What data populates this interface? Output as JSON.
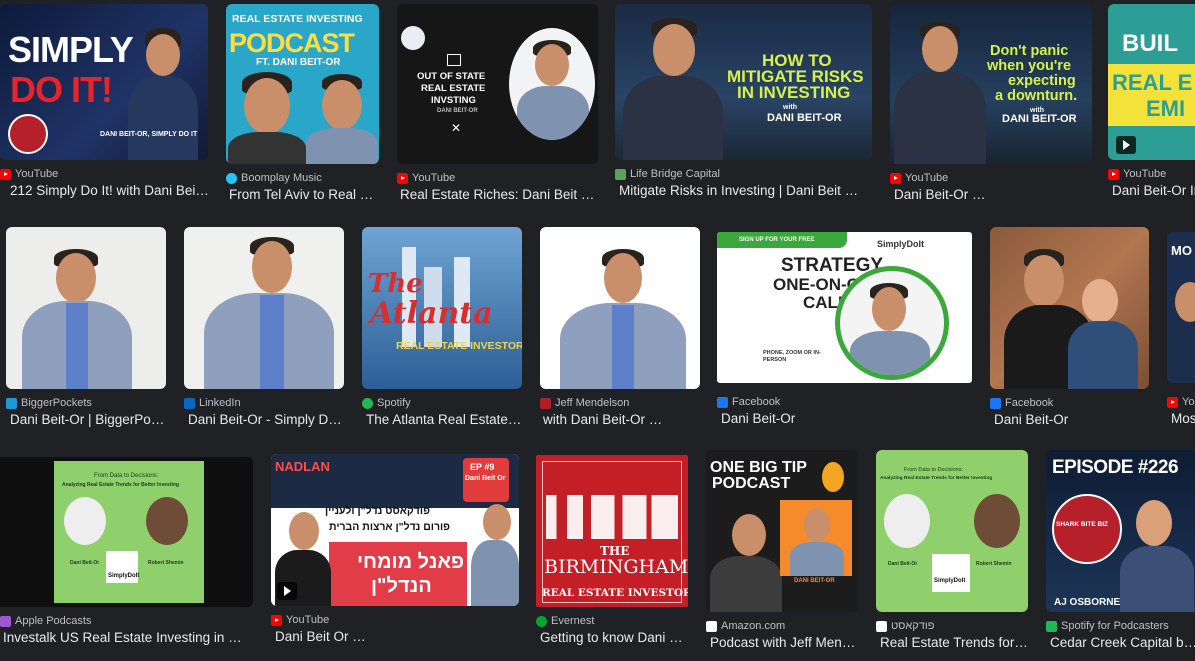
{
  "results": [
    {
      "source": "YouTube",
      "title": "212 Simply Do It! with Dani Bei…",
      "overlay": [
        "SIMPLY",
        "DO IT!",
        "DANI BEIT-OR, SIMPLY DO IT",
        "SHARK BITE BIZ"
      ]
    },
    {
      "source": "Boomplay Music",
      "title": "From Tel Aviv to Real …",
      "overlay": [
        "REAL ESTATE INVESTING",
        "PODCAST",
        "FT. DANI BEIT-OR"
      ]
    },
    {
      "source": "YouTube",
      "title": "Real Estate Riches: Dani Beit …",
      "overlay": [
        "OUT OF STATE",
        "REAL ESTATE",
        "INVSTING",
        "DANI BEIT-OR"
      ]
    },
    {
      "source": "Life Bridge Capital",
      "title": "Mitigate Risks in Investing | Dani Beit …",
      "overlay": [
        "HOW TO",
        "MITIGATE RISKS",
        "IN INVESTING",
        "with",
        "DANI BEIT-OR"
      ]
    },
    {
      "source": "YouTube",
      "title": "Dani Beit-Or …",
      "overlay": [
        "Don't panic",
        "when you're",
        "expecting",
        "a downturn.",
        "with",
        "DANI BEIT-OR"
      ]
    },
    {
      "source": "YouTube",
      "title": "Dani Beit-Or In",
      "overlay": [
        "BUIL",
        "REAL E",
        "EMI"
      ]
    },
    {
      "source": "BiggerPockets",
      "title": "Dani Beit-Or | BiggerPo…"
    },
    {
      "source": "LinkedIn",
      "title": "Dani Beit-Or - Simply D…"
    },
    {
      "source": "Spotify",
      "title": "The Atlanta Real Estate…",
      "overlay": [
        "The",
        "Atlanta",
        "REAL ESTATE INVESTOR"
      ]
    },
    {
      "source": "Jeff Mendelson",
      "title": "with Dani Beit-Or …"
    },
    {
      "source": "Facebook",
      "title": "Dani Beit-Or",
      "overlay": [
        "SIGN UP FOR YOUR FREE",
        "SimplyDoIt",
        "STRATEGY",
        "ONE-ON-ONE",
        "CALL",
        "PHONE, ZOOM OR IN-PERSON"
      ]
    },
    {
      "source": "Facebook",
      "title": "Dani Beit-Or"
    },
    {
      "source": "Yo",
      "title": "Mos",
      "overlay": [
        "MO"
      ]
    },
    {
      "source": "Apple Podcasts",
      "title": "Investalk US Real Estate Investing in …",
      "overlay": [
        "From Data to Decisions:",
        "Analyzing Real Estate Trends for Better Investing",
        "Dani Beit-Or",
        "Robert Shemin",
        "SimplyDoIt"
      ]
    },
    {
      "source": "YouTube",
      "title": "Dani Beit Or …",
      "overlay": [
        "NADLAN",
        "EP #9",
        "Dani Beit Or",
        "פודקאסט נדל\"ן ולעניין",
        "פורום נדל\"ן ארצות הברית",
        "פאנל מומחי",
        "הנדל\"ן"
      ]
    },
    {
      "source": "Evernest",
      "title": "Getting to know Dani …",
      "overlay": [
        "THE",
        "BIRMINGHAM",
        "REAL ESTATE INVESTOR"
      ]
    },
    {
      "source": "Amazon.com",
      "title": "Podcast with Jeff Men…",
      "overlay": [
        "ONE BIG TIP",
        "PODCAST",
        "DANI BEIT-OR"
      ]
    },
    {
      "source": "פודקאסט",
      "title": "Real Estate Trends for…",
      "overlay": [
        "From Data to Decisions:",
        "Analyzing Real Estate Trends for Better Investing",
        "Dani Beit-Or",
        "Robert Shemin",
        "SimplyDoIt"
      ]
    },
    {
      "source": "Spotify for Podcasters",
      "title": "Cedar Creek Capital b…",
      "overlay": [
        "EPISODE #226",
        "SHARK BITE BIZ",
        "AJ OSBORNE"
      ]
    }
  ]
}
